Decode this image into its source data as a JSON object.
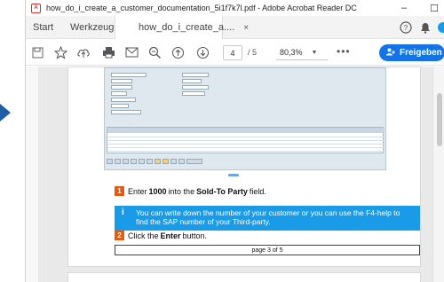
{
  "window": {
    "title": "how_do_i_create_a_customer_documentation_5i1f7k7l.pdf - Adobe Acrobat Reader DC",
    "pdf_icon": "pdf-file-icon",
    "controls": {
      "minimize": "–",
      "maximize": "☐"
    }
  },
  "tabs": {
    "start": "Start",
    "tools": "Werkzeuge",
    "document": "how_do_i_create_a....",
    "document_close": "×"
  },
  "toolbar": {
    "page_current": "4",
    "page_total": "/ 5",
    "zoom": "80,3%",
    "more": "•••",
    "share_label": "Freigeben"
  },
  "document": {
    "step1": {
      "number": "1",
      "prefix": "Enter",
      "value": "1000",
      "middle": "into the",
      "field": "Sold-To Party",
      "suffix": "field."
    },
    "info": {
      "icon": "i",
      "text": "You can write down the number of your customer or you can use the F4-help to find the SAP number of your Third-party."
    },
    "step2": {
      "number": "2",
      "prefix": "Click the",
      "button": "Enter",
      "suffix": "button."
    },
    "page_label": "page 3 of 5"
  },
  "colors": {
    "accent": "#1473e6",
    "step_badge": "#e35b12",
    "info_box": "#1a9be8",
    "arrow": "#1f5fa8"
  }
}
